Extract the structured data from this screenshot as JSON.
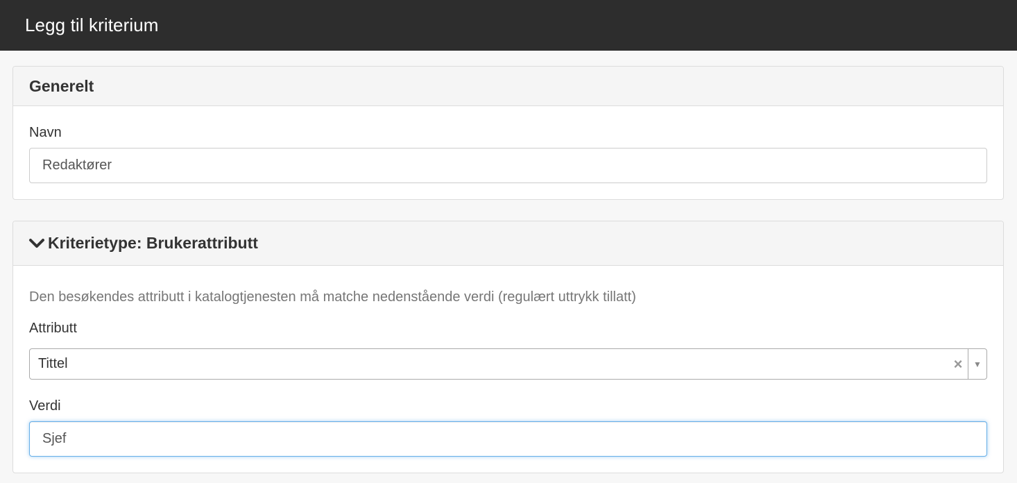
{
  "header": {
    "title": "Legg til kriterium"
  },
  "general": {
    "heading": "Generelt",
    "name_label": "Navn",
    "name_value": "Redaktører"
  },
  "criterion": {
    "heading": "Kriterietype: Brukerattributt",
    "help_text": "Den besøkendes attributt i katalogtjenesten må matche nedenstående verdi (regulært uttrykk tillatt)",
    "attribute_label": "Attributt",
    "attribute_selected": "Tittel",
    "clear_symbol": "×",
    "dropdown_symbol": "▼",
    "value_label": "Verdi",
    "value_value": "Sjef"
  },
  "colors": {
    "topbar_bg": "#2d2d2d",
    "focus_border": "#66afe9"
  }
}
